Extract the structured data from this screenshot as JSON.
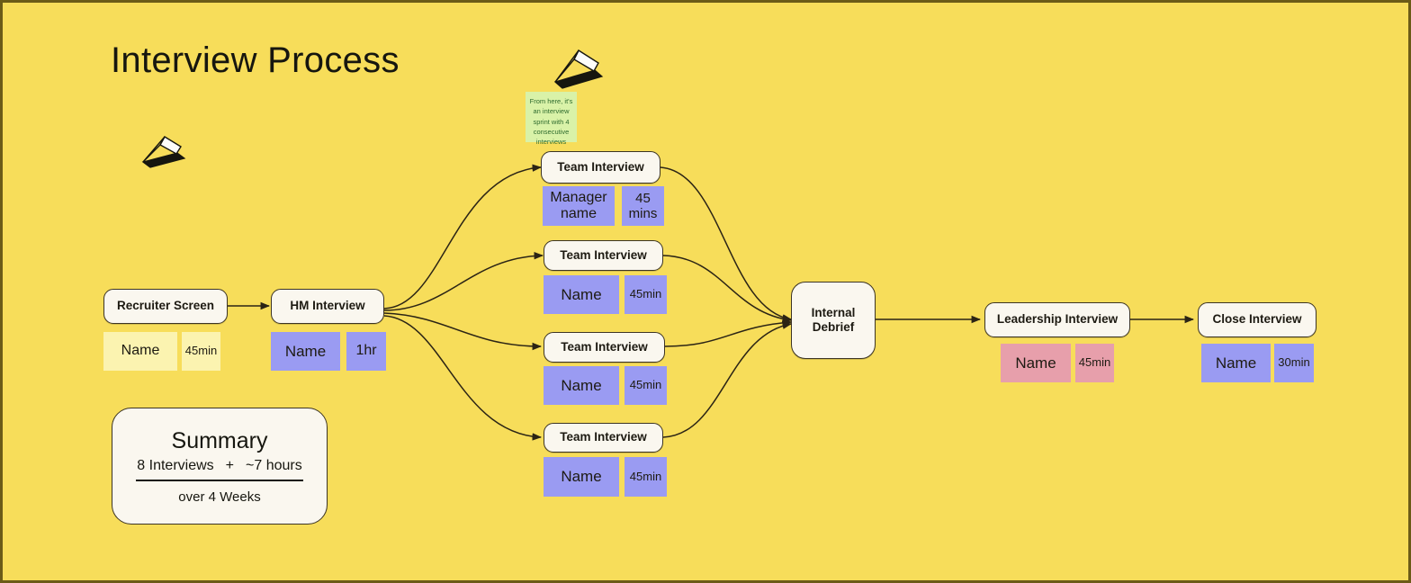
{
  "canvas": {
    "title": "Interview Process",
    "background_color": "#f7dd5a",
    "border_color": "#6b5b17"
  },
  "annotation_note": {
    "text": "From here, it's an interview sprint with 4 consecutive interviews",
    "color": "#d9f2a8",
    "text_color": "#2e6b2e"
  },
  "icons": {
    "laptop_left": "laptop-icon",
    "laptop_center": "laptop-icon"
  },
  "nodes": {
    "recruiter_screen": {
      "label": "Recruiter Screen",
      "chips": [
        {
          "text": "Name",
          "color": "#fbf3b0",
          "size": "large"
        },
        {
          "text": "45min",
          "color": "#fbf3b0",
          "size": "small"
        }
      ]
    },
    "hm_interview": {
      "label": "HM Interview",
      "chips": [
        {
          "text": "Name",
          "color": "#9a9bf2",
          "size": "large"
        },
        {
          "text": "1hr",
          "color": "#9a9bf2",
          "size": "small"
        }
      ]
    },
    "team_interview_1": {
      "label": "Team Interview",
      "chips": [
        {
          "text": "Manager name",
          "color": "#9a9bf2",
          "size": "large"
        },
        {
          "text": "45 mins",
          "color": "#9a9bf2",
          "size": "small"
        }
      ]
    },
    "team_interview_2": {
      "label": "Team Interview",
      "chips": [
        {
          "text": "Name",
          "color": "#9a9bf2",
          "size": "large"
        },
        {
          "text": "45min",
          "color": "#9a9bf2",
          "size": "small"
        }
      ]
    },
    "team_interview_3": {
      "label": "Team Interview",
      "chips": [
        {
          "text": "Name",
          "color": "#9a9bf2",
          "size": "large"
        },
        {
          "text": "45min",
          "color": "#9a9bf2",
          "size": "small"
        }
      ]
    },
    "team_interview_4": {
      "label": "Team Interview",
      "chips": [
        {
          "text": "Name",
          "color": "#9a9bf2",
          "size": "large"
        },
        {
          "text": "45min",
          "color": "#9a9bf2",
          "size": "small"
        }
      ]
    },
    "internal_debrief": {
      "label": "Internal Debrief"
    },
    "leadership_interview": {
      "label": "Leadership Interview",
      "chips": [
        {
          "text": "Name",
          "color": "#e79fab",
          "size": "large"
        },
        {
          "text": "45min",
          "color": "#e79fab",
          "size": "small"
        }
      ]
    },
    "close_interview": {
      "label": "Close Interview",
      "chips": [
        {
          "text": "Name",
          "color": "#9a9bf2",
          "size": "large"
        },
        {
          "text": "30min",
          "color": "#9a9bf2",
          "size": "small"
        }
      ]
    }
  },
  "summary": {
    "title": "Summary",
    "count": "8 Interviews",
    "operator": "+",
    "duration": "~7 hours",
    "footer": "over 4 Weeks"
  }
}
